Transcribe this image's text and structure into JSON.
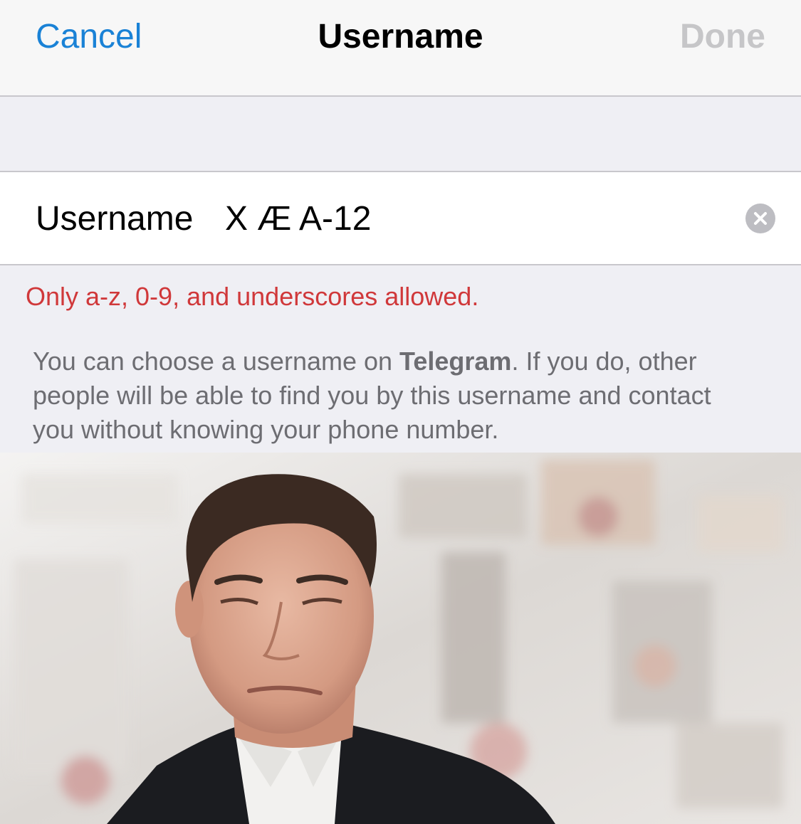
{
  "nav": {
    "cancel_label": "Cancel",
    "title": "Username",
    "done_label": "Done"
  },
  "field": {
    "label": "Username",
    "value": "X Æ A-12"
  },
  "error": "Only a-z, 0-9, and underscores allowed.",
  "info": {
    "text_before": "You can choose a username on ",
    "bold": "Telegram",
    "text_after": ". If you do, other people will be able to find you by this username and contact you without knowing your phone number."
  },
  "icons": {
    "clear": "clear-icon"
  },
  "colors": {
    "accent": "#1a82d6",
    "error": "#d0383a",
    "disabled": "#c6c6c8"
  }
}
